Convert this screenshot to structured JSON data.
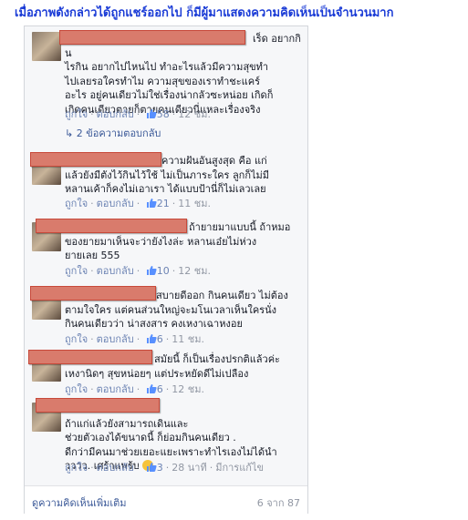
{
  "headline": "เมื่อภาพดังกล่าวได้ถูกแชร์ออกไป ก็มีผู้มาแสดงความคิดเห็นเป็นจำนวนมาก",
  "labels": {
    "like": "ถูกใจ",
    "reply": "ตอบกลับ"
  },
  "comments": [
    {
      "text": "เร็ด อยากกิน\nไรกิน อยากไปไหนไป ทำอะไรแล้วมีความสุขทำ\nไปเลยรอใครทำไม ความสุขของเราทำชะแคร์\nอะไร อยู่คนเดียวไม่ใช่เรื่องน่ากลัวซะหน่อย เกิดก็\nเกิดคนเดียวตายก็ตายคนเดียวนี่แหละเรื่องจริง",
      "likes": "58",
      "time": "12 ชม.",
      "replies": "2 ข้อความตอบกลับ"
    },
    {
      "text": "ความฝันอันสูงสุด คือ แก่\nแล้วยังมีตังไว้กินไว้ใช้ ไม่เป็นภาระใคร ลูกก็ไม่มี\nหลานเค้าก็คงไม่เอาเรา ได้แบบป้านี่ก็ไม่เลวเลย",
      "likes": "21",
      "time": "11 ชม."
    },
    {
      "text": "ถ้ายายมาแบบนี้ ถ้าหมอ\nของยายมาเห็นจะว่ายังไงล่ะ หลานเอ๋ยไม่ห่วง\nยายเลย 555",
      "likes": "10",
      "time": "12 ชม."
    },
    {
      "text": "สบายดีออก กินคนเดียว ไม่ต้อง\nตามใจใคร แต่คนส่วนใหญ่จะมโนเวลาเห็นใครนั่ง\nกินคนเดียวว่า น่าสงสาร คงเหงาเฉาหงอย",
      "likes": "6",
      "time": "11 ชม."
    },
    {
      "text": "สมัยนี้ ก็เป็นเรื่องปรกติแล้วค่ะ\nเหงานิดๆ สุขหน่อยๆ แต่ประหยัดดีไม่เปลือง",
      "likes": "6",
      "time": "12 ชม."
    },
    {
      "text": "ถ้าแก่แล้วยังสามารถเดินและ\nช่วยตัวเองได้ขนาดนี้ ก็ย่อมกินคนเดียว .\nดีกว่ามีคนมาช่วยเยอะแยะเพราะทำไรเองไม่ได้นำ\nวววว. เศร้าแพร้บ",
      "likes": "3",
      "time": "28 นาที",
      "edited": "มีการแก้ไข"
    }
  ],
  "footer": {
    "more": "ดูความคิดเห็นเพิ่มเติม",
    "pager": "6 จาก 87"
  }
}
